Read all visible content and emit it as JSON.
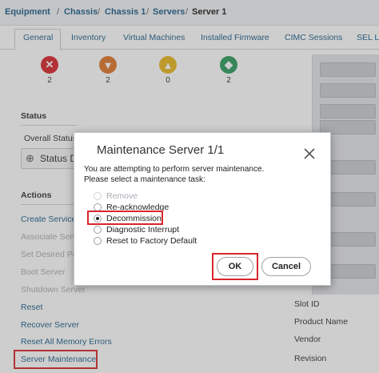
{
  "breadcrumb": {
    "items": [
      "Equipment",
      "Chassis",
      "Chassis 1",
      "Servers"
    ],
    "separator": "/",
    "current": "Server 1"
  },
  "tabs": [
    {
      "label": "General",
      "active": true
    },
    {
      "label": "Inventory"
    },
    {
      "label": "Virtual Machines"
    },
    {
      "label": "Installed Firmware"
    },
    {
      "label": "CIMC Sessions"
    },
    {
      "label": "SEL L"
    }
  ],
  "faults": [
    {
      "icon": "critical-x-icon",
      "color": "#d9262c",
      "count": "2"
    },
    {
      "icon": "major-down-arrow-icon",
      "color": "#e0782a",
      "count": "2"
    },
    {
      "icon": "minor-warning-icon",
      "color": "#e9b81f",
      "count": "0"
    },
    {
      "icon": "warning-diamond-icon",
      "color": "#2e9c5f",
      "count": "2"
    }
  ],
  "status": {
    "heading": "Status",
    "overall_label": "Overall Status",
    "status_button": "Status D"
  },
  "actions": {
    "heading": "Actions",
    "items": [
      {
        "label": "Create Service",
        "enabled": true
      },
      {
        "label": "Associate Serv",
        "enabled": false
      },
      {
        "label": "Set Desired Po",
        "enabled": false
      },
      {
        "label": "Boot Server",
        "enabled": false
      },
      {
        "label": "Shutdown Server",
        "enabled": false
      },
      {
        "label": "Reset",
        "enabled": true
      },
      {
        "label": "Recover Server",
        "enabled": true
      },
      {
        "label": "Reset All Memory Errors",
        "enabled": true
      },
      {
        "label": "Server Maintenance",
        "enabled": true,
        "highlighted": true
      }
    ]
  },
  "properties": [
    "Slot ID",
    "Product Name",
    "Vendor",
    "Revision"
  ],
  "dialog": {
    "title": "Maintenance Server 1/1",
    "line1": "You are attempting to perform server maintenance.",
    "line2": "Please select a maintenance task:",
    "options": [
      {
        "label": "Remove",
        "disabled": true
      },
      {
        "label": "Re-acknowledge"
      },
      {
        "label": "Decommission",
        "selected": true
      },
      {
        "label": "Diagnostic Interrupt"
      },
      {
        "label": "Reset to Factory Default"
      }
    ],
    "ok_label": "OK",
    "cancel_label": "Cancel"
  },
  "colors": {
    "link": "#1f5f8b",
    "highlight": "#d9262c"
  }
}
